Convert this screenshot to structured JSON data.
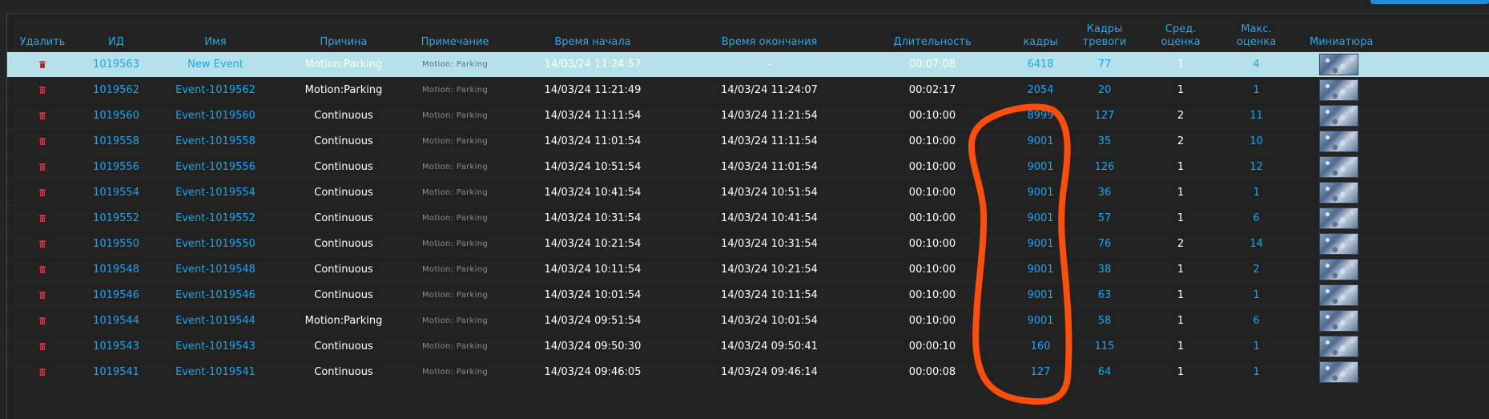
{
  "columns": {
    "delete": "Удалить",
    "id": "ИД",
    "name": "Имя",
    "cause": "Причина",
    "note": "Примечание",
    "start": "Время начала",
    "end": "Время окончания",
    "duration": "Длительность",
    "frames": "кадры",
    "alarm_frames_1": "Кадры",
    "alarm_frames_2": "тревоги",
    "avg_score_1": "Сред.",
    "avg_score_2": "оценка",
    "max_score_1": "Макс.",
    "max_score_2": "оценка",
    "thumbnail": "Миниатюра"
  },
  "rows": [
    {
      "id": "1019563",
      "name": "New Event",
      "cause": "Motion:Parking",
      "note": "Motion: Parking",
      "start": "14/03/24 11:24:57",
      "end": "-",
      "duration": "00:07:08",
      "frames": "6418",
      "alarm_frames": "77",
      "avg": "1",
      "max": "4"
    },
    {
      "id": "1019562",
      "name": "Event-1019562",
      "cause": "Motion:Parking",
      "note": "Motion: Parking",
      "start": "14/03/24 11:21:49",
      "end": "14/03/24 11:24:07",
      "duration": "00:02:17",
      "frames": "2054",
      "alarm_frames": "20",
      "avg": "1",
      "max": "1"
    },
    {
      "id": "1019560",
      "name": "Event-1019560",
      "cause": "Continuous",
      "note": "Motion: Parking",
      "start": "14/03/24 11:11:54",
      "end": "14/03/24 11:21:54",
      "duration": "00:10:00",
      "frames": "8999",
      "alarm_frames": "127",
      "avg": "2",
      "max": "11"
    },
    {
      "id": "1019558",
      "name": "Event-1019558",
      "cause": "Continuous",
      "note": "Motion: Parking",
      "start": "14/03/24 11:01:54",
      "end": "14/03/24 11:11:54",
      "duration": "00:10:00",
      "frames": "9001",
      "alarm_frames": "35",
      "avg": "2",
      "max": "10"
    },
    {
      "id": "1019556",
      "name": "Event-1019556",
      "cause": "Continuous",
      "note": "Motion: Parking",
      "start": "14/03/24 10:51:54",
      "end": "14/03/24 11:01:54",
      "duration": "00:10:00",
      "frames": "9001",
      "alarm_frames": "126",
      "avg": "1",
      "max": "12"
    },
    {
      "id": "1019554",
      "name": "Event-1019554",
      "cause": "Continuous",
      "note": "Motion: Parking",
      "start": "14/03/24 10:41:54",
      "end": "14/03/24 10:51:54",
      "duration": "00:10:00",
      "frames": "9001",
      "alarm_frames": "36",
      "avg": "1",
      "max": "1"
    },
    {
      "id": "1019552",
      "name": "Event-1019552",
      "cause": "Continuous",
      "note": "Motion: Parking",
      "start": "14/03/24 10:31:54",
      "end": "14/03/24 10:41:54",
      "duration": "00:10:00",
      "frames": "9001",
      "alarm_frames": "57",
      "avg": "1",
      "max": "6"
    },
    {
      "id": "1019550",
      "name": "Event-1019550",
      "cause": "Continuous",
      "note": "Motion: Parking",
      "start": "14/03/24 10:21:54",
      "end": "14/03/24 10:31:54",
      "duration": "00:10:00",
      "frames": "9001",
      "alarm_frames": "76",
      "avg": "2",
      "max": "14"
    },
    {
      "id": "1019548",
      "name": "Event-1019548",
      "cause": "Continuous",
      "note": "Motion: Parking",
      "start": "14/03/24 10:11:54",
      "end": "14/03/24 10:21:54",
      "duration": "00:10:00",
      "frames": "9001",
      "alarm_frames": "38",
      "avg": "1",
      "max": "2"
    },
    {
      "id": "1019546",
      "name": "Event-1019546",
      "cause": "Continuous",
      "note": "Motion: Parking",
      "start": "14/03/24 10:01:54",
      "end": "14/03/24 10:11:54",
      "duration": "00:10:00",
      "frames": "9001",
      "alarm_frames": "63",
      "avg": "1",
      "max": "1"
    },
    {
      "id": "1019544",
      "name": "Event-1019544",
      "cause": "Motion:Parking",
      "note": "Motion: Parking",
      "start": "14/03/24 09:51:54",
      "end": "14/03/24 10:01:54",
      "duration": "00:10:00",
      "frames": "9001",
      "alarm_frames": "58",
      "avg": "1",
      "max": "6"
    },
    {
      "id": "1019543",
      "name": "Event-1019543",
      "cause": "Continuous",
      "note": "Motion: Parking",
      "start": "14/03/24 09:50:30",
      "end": "14/03/24 09:50:41",
      "duration": "00:00:10",
      "frames": "160",
      "alarm_frames": "115",
      "avg": "1",
      "max": "1"
    },
    {
      "id": "1019541",
      "name": "Event-1019541",
      "cause": "Continuous",
      "note": "Motion: Parking",
      "start": "14/03/24 09:46:05",
      "end": "14/03/24 09:46:14",
      "duration": "00:00:08",
      "frames": "127",
      "alarm_frames": "64",
      "avg": "1",
      "max": "1"
    }
  ],
  "colors": {
    "background": "#222222",
    "header_text": "#2aa7e8",
    "link_text": "#1aa6ee",
    "highlight_row": "#b4e1ea",
    "delete_icon": "#e0303a",
    "annotation_stroke": "#ff4d0a"
  },
  "icons": {
    "delete": "trash-icon",
    "thumbnail": "event-thumbnail"
  }
}
